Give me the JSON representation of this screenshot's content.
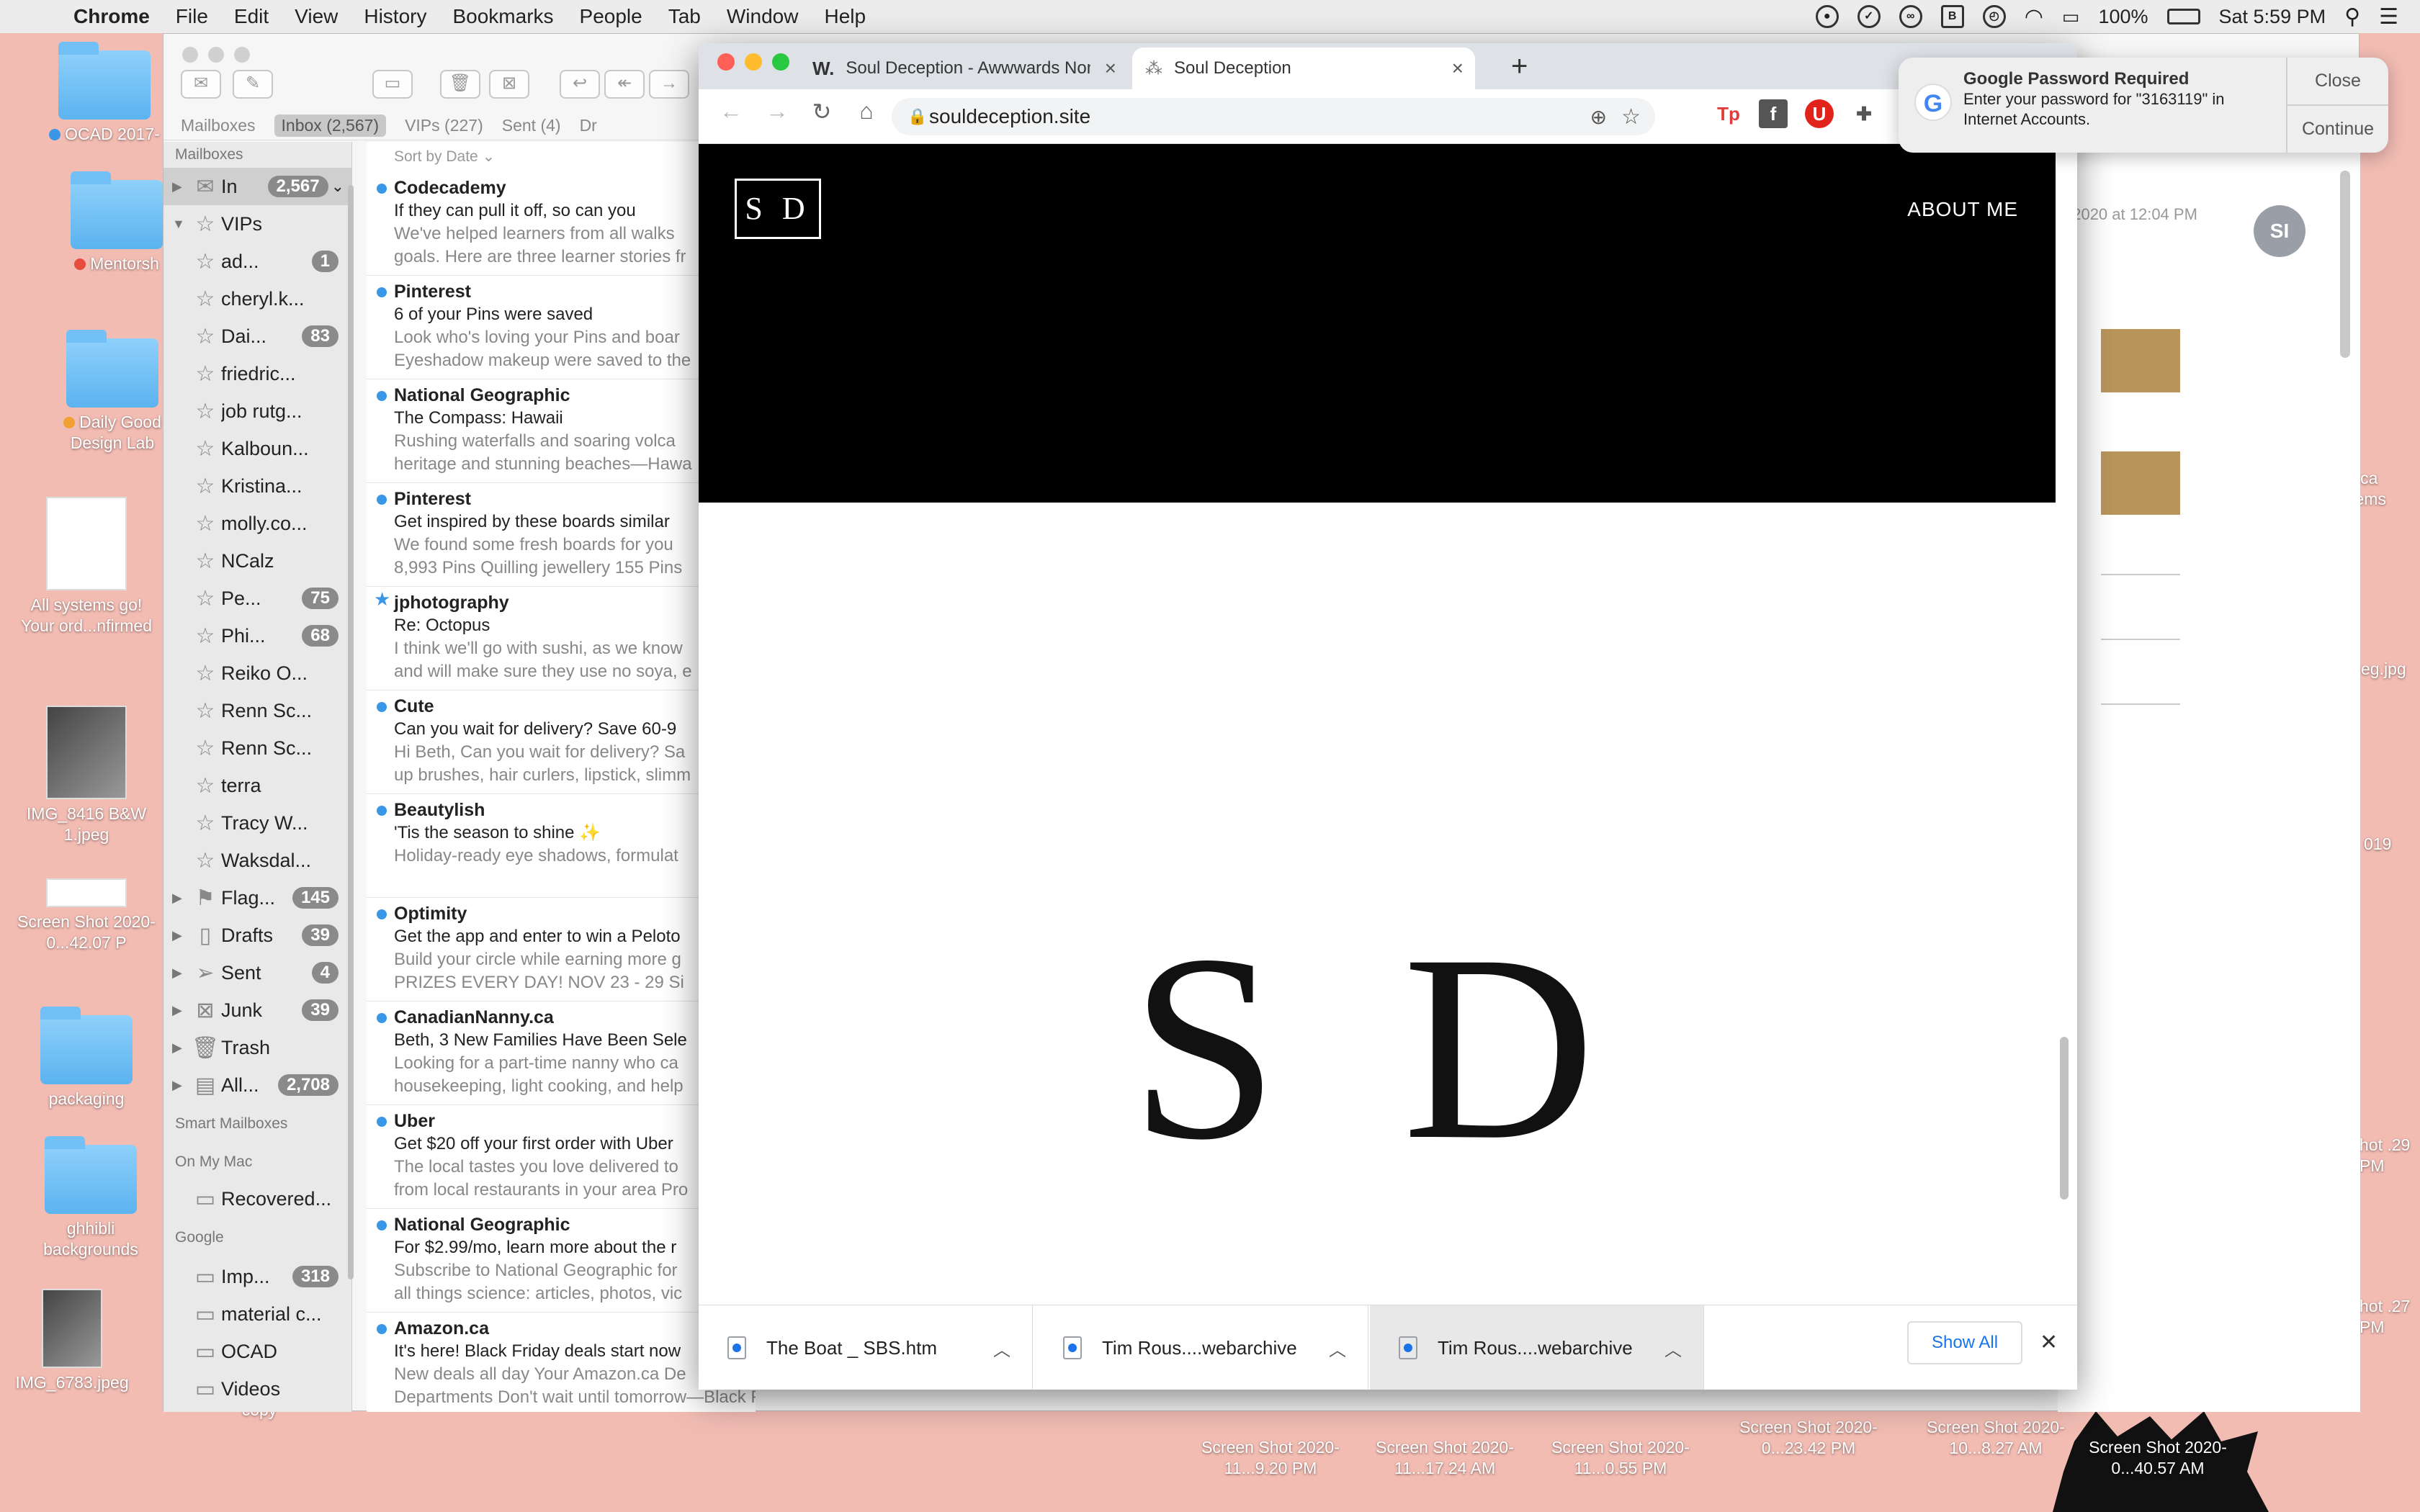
{
  "menubar": {
    "app": "Chrome",
    "items": [
      "File",
      "Edit",
      "View",
      "History",
      "Bookmarks",
      "People",
      "Tab",
      "Window",
      "Help"
    ],
    "battery": "100%",
    "clock": "Sat 5:59 PM"
  },
  "desktop": {
    "left_icons": [
      {
        "label": "OCAD 2017-",
        "dot": "#3b96e8"
      },
      {
        "label": "Mentorsh",
        "dot": "#e74c3c"
      },
      {
        "label": "Daily Good Design Lab",
        "dot": "#f0a030"
      },
      {
        "label": "All systems go! Your ord...nfirmed"
      },
      {
        "label": "IMG_8416 B&W 1.jpeg"
      },
      {
        "label": "Screen Shot 2020-0...42.07 P"
      },
      {
        "label": "packaging"
      },
      {
        "label": "ghhibli backgrounds"
      },
      {
        "label": "IMG_6783.jpeg"
      }
    ],
    "right_icons": [
      {
        "label": "n.ca items"
      },
      {
        "label": "eg.jpg"
      },
      {
        "label": "019"
      },
      {
        "label": "hot .29 PM"
      },
      {
        "label": "hot .27 PM"
      }
    ],
    "bottom_icons": [
      {
        "label": "Screen Shot 2020-11...9.20 PM"
      },
      {
        "label": "Screen Shot 2020-11...17.24 AM"
      },
      {
        "label": "Screen Shot 2020-11...0.55 PM"
      },
      {
        "label": "Screen Shot 2020-0...23.42 PM"
      },
      {
        "label": "Screen Shot 2020-10...8.27 AM"
      },
      {
        "label": "Screen Shot 2020-0...40.57 AM"
      }
    ],
    "copy_label": "copy"
  },
  "mail": {
    "favbar": {
      "mailboxes": "Mailboxes",
      "inbox": "Inbox (2,567)",
      "vips": "VIPs (227)",
      "sent": "Sent (4)",
      "drafts": "Dr"
    },
    "sidebar": {
      "heading": "Mailboxes",
      "inbox": {
        "label": "In",
        "count": "2,567"
      },
      "vips_label": "VIPs",
      "vips": [
        {
          "label": "ad...",
          "count": "1"
        },
        {
          "label": "cheryl.k...",
          "count": ""
        },
        {
          "label": "Dai...",
          "count": "83"
        },
        {
          "label": "friedric...",
          "count": ""
        },
        {
          "label": "job rutg...",
          "count": ""
        },
        {
          "label": "Kalboun...",
          "count": ""
        },
        {
          "label": "Kristina...",
          "count": ""
        },
        {
          "label": "molly.co...",
          "count": ""
        },
        {
          "label": "NCalz",
          "count": ""
        },
        {
          "label": "Pe...",
          "count": "75"
        },
        {
          "label": "Phi...",
          "count": "68"
        },
        {
          "label": "Reiko O...",
          "count": ""
        },
        {
          "label": "Renn Sc...",
          "count": ""
        },
        {
          "label": "Renn Sc...",
          "count": ""
        },
        {
          "label": "terra",
          "count": ""
        },
        {
          "label": "Tracy W...",
          "count": ""
        },
        {
          "label": "Waksdal...",
          "count": ""
        }
      ],
      "folders": [
        {
          "label": "Flag...",
          "count": "145",
          "icon": "flag-icon"
        },
        {
          "label": "Drafts",
          "count": "39",
          "icon": "doc-icon"
        },
        {
          "label": "Sent",
          "count": "4",
          "icon": "send-icon"
        },
        {
          "label": "Junk",
          "count": "39",
          "icon": "junk-icon"
        },
        {
          "label": "Trash",
          "count": "",
          "icon": "trash-icon"
        },
        {
          "label": "All...",
          "count": "2,708",
          "icon": "archive-icon"
        }
      ],
      "smart_heading": "Smart Mailboxes",
      "onmymac_heading": "On My Mac",
      "onmymac": [
        {
          "label": "Recovered..."
        }
      ],
      "google_heading": "Google",
      "google": [
        {
          "label": "Imp...",
          "count": "318"
        },
        {
          "label": "material c...",
          "count": ""
        },
        {
          "label": "OCAD",
          "count": ""
        },
        {
          "label": "Videos",
          "count": ""
        }
      ]
    },
    "sort_label": "Sort by Date",
    "messages": [
      {
        "from": "Codecademy",
        "subject": "If they can pull it off, so can you",
        "preview1": "We've helped learners from all walks",
        "preview2": "goals. Here are three learner stories fr",
        "marker": "dot"
      },
      {
        "from": "Pinterest",
        "subject": "6 of your Pins were saved",
        "preview1": "Look who's loving your Pins and boar",
        "preview2": "Eyeshadow makeup were saved to the",
        "marker": "dot"
      },
      {
        "from": "National Geographic",
        "subject": "The Compass: Hawaii",
        "preview1": "Rushing waterfalls and soaring volca",
        "preview2": "heritage and stunning beaches—Hawa",
        "marker": "dot"
      },
      {
        "from": "Pinterest",
        "subject": "Get inspired by these boards similar",
        "preview1": "We found some fresh boards for you",
        "preview2": "8,993 Pins Quilling jewellery 155 Pins",
        "marker": "dot"
      },
      {
        "from": "jphotography",
        "subject": "Re: Octopus",
        "preview1": "I think we'll go with sushi, as we know",
        "preview2": "and will make sure they use no soya, e",
        "marker": "star"
      },
      {
        "from": "Cute",
        "subject": "Can you wait for delivery? Save 60-9",
        "preview1": "Hi Beth, Can you wait for delivery? Sa",
        "preview2": "up brushes, hair curlers, lipstick, slimm",
        "marker": "dot"
      },
      {
        "from": "Beautylish",
        "subject": "'Tis the season to shine ✨",
        "preview1": "Holiday-ready eye shadows, formulat",
        "preview2": "",
        "marker": "dot"
      },
      {
        "from": "Optimity",
        "subject": "Get the app and enter to win a Peloto",
        "preview1": "Build your circle while earning more g",
        "preview2": "PRIZES EVERY DAY! NOV 23 - 29 Si",
        "marker": "dot"
      },
      {
        "from": "CanadianNanny.ca",
        "subject": "Beth, 3 New Families Have Been Sele",
        "preview1": "Looking for a part-time nanny who ca",
        "preview2": "housekeeping, light cooking, and help",
        "marker": "dot"
      },
      {
        "from": "Uber",
        "subject": "Get $20 off your first order with Uber",
        "preview1": "The local tastes you love delivered to",
        "preview2": "from local restaurants in your area Pro",
        "marker": "dot"
      },
      {
        "from": "National Geographic",
        "subject": "For $2.99/mo, learn more about the r",
        "preview1": "Subscribe to National Geographic for",
        "preview2": "all things science: articles, photos, vic",
        "marker": "dot"
      },
      {
        "from": "Amazon.ca",
        "subject": "It's here! Black Friday deals start now",
        "preview1": "New deals all day Your Amazon.ca De",
        "preview2": "Departments Don't wait until tomorrow—Black Friday deals...",
        "marker": "dot"
      }
    ],
    "reading": {
      "date": ", 2020 at 12:04 PM",
      "avatar": "SI"
    }
  },
  "chrome": {
    "tabs": [
      {
        "label": "Soul Deception - Awwwards Nom",
        "favicon": "W."
      },
      {
        "label": "Soul Deception",
        "favicon": "⁂"
      }
    ],
    "url": "souldeception.site",
    "extensions": [
      {
        "label": "Tp",
        "color": "#e23b3b"
      },
      {
        "label": "f",
        "color": "#555"
      },
      {
        "label": "U",
        "color": "#e2231a"
      },
      {
        "label": "✚",
        "color": "#555"
      }
    ],
    "page": {
      "logo": "S D",
      "nav": "ABOUT ME",
      "mark": "S D"
    },
    "downloads": [
      {
        "name": "The Boat _ SBS.htm"
      },
      {
        "name": "Tim Rous....webarchive"
      },
      {
        "name": "Tim Rous....webarchive"
      }
    ],
    "show_all": "Show All"
  },
  "notification": {
    "title": "Google Password Required",
    "line1": "Enter your password for \"3163119\" in",
    "line2": "Internet Accounts.",
    "close": "Close",
    "continue": "Continue",
    "logo": "G"
  }
}
